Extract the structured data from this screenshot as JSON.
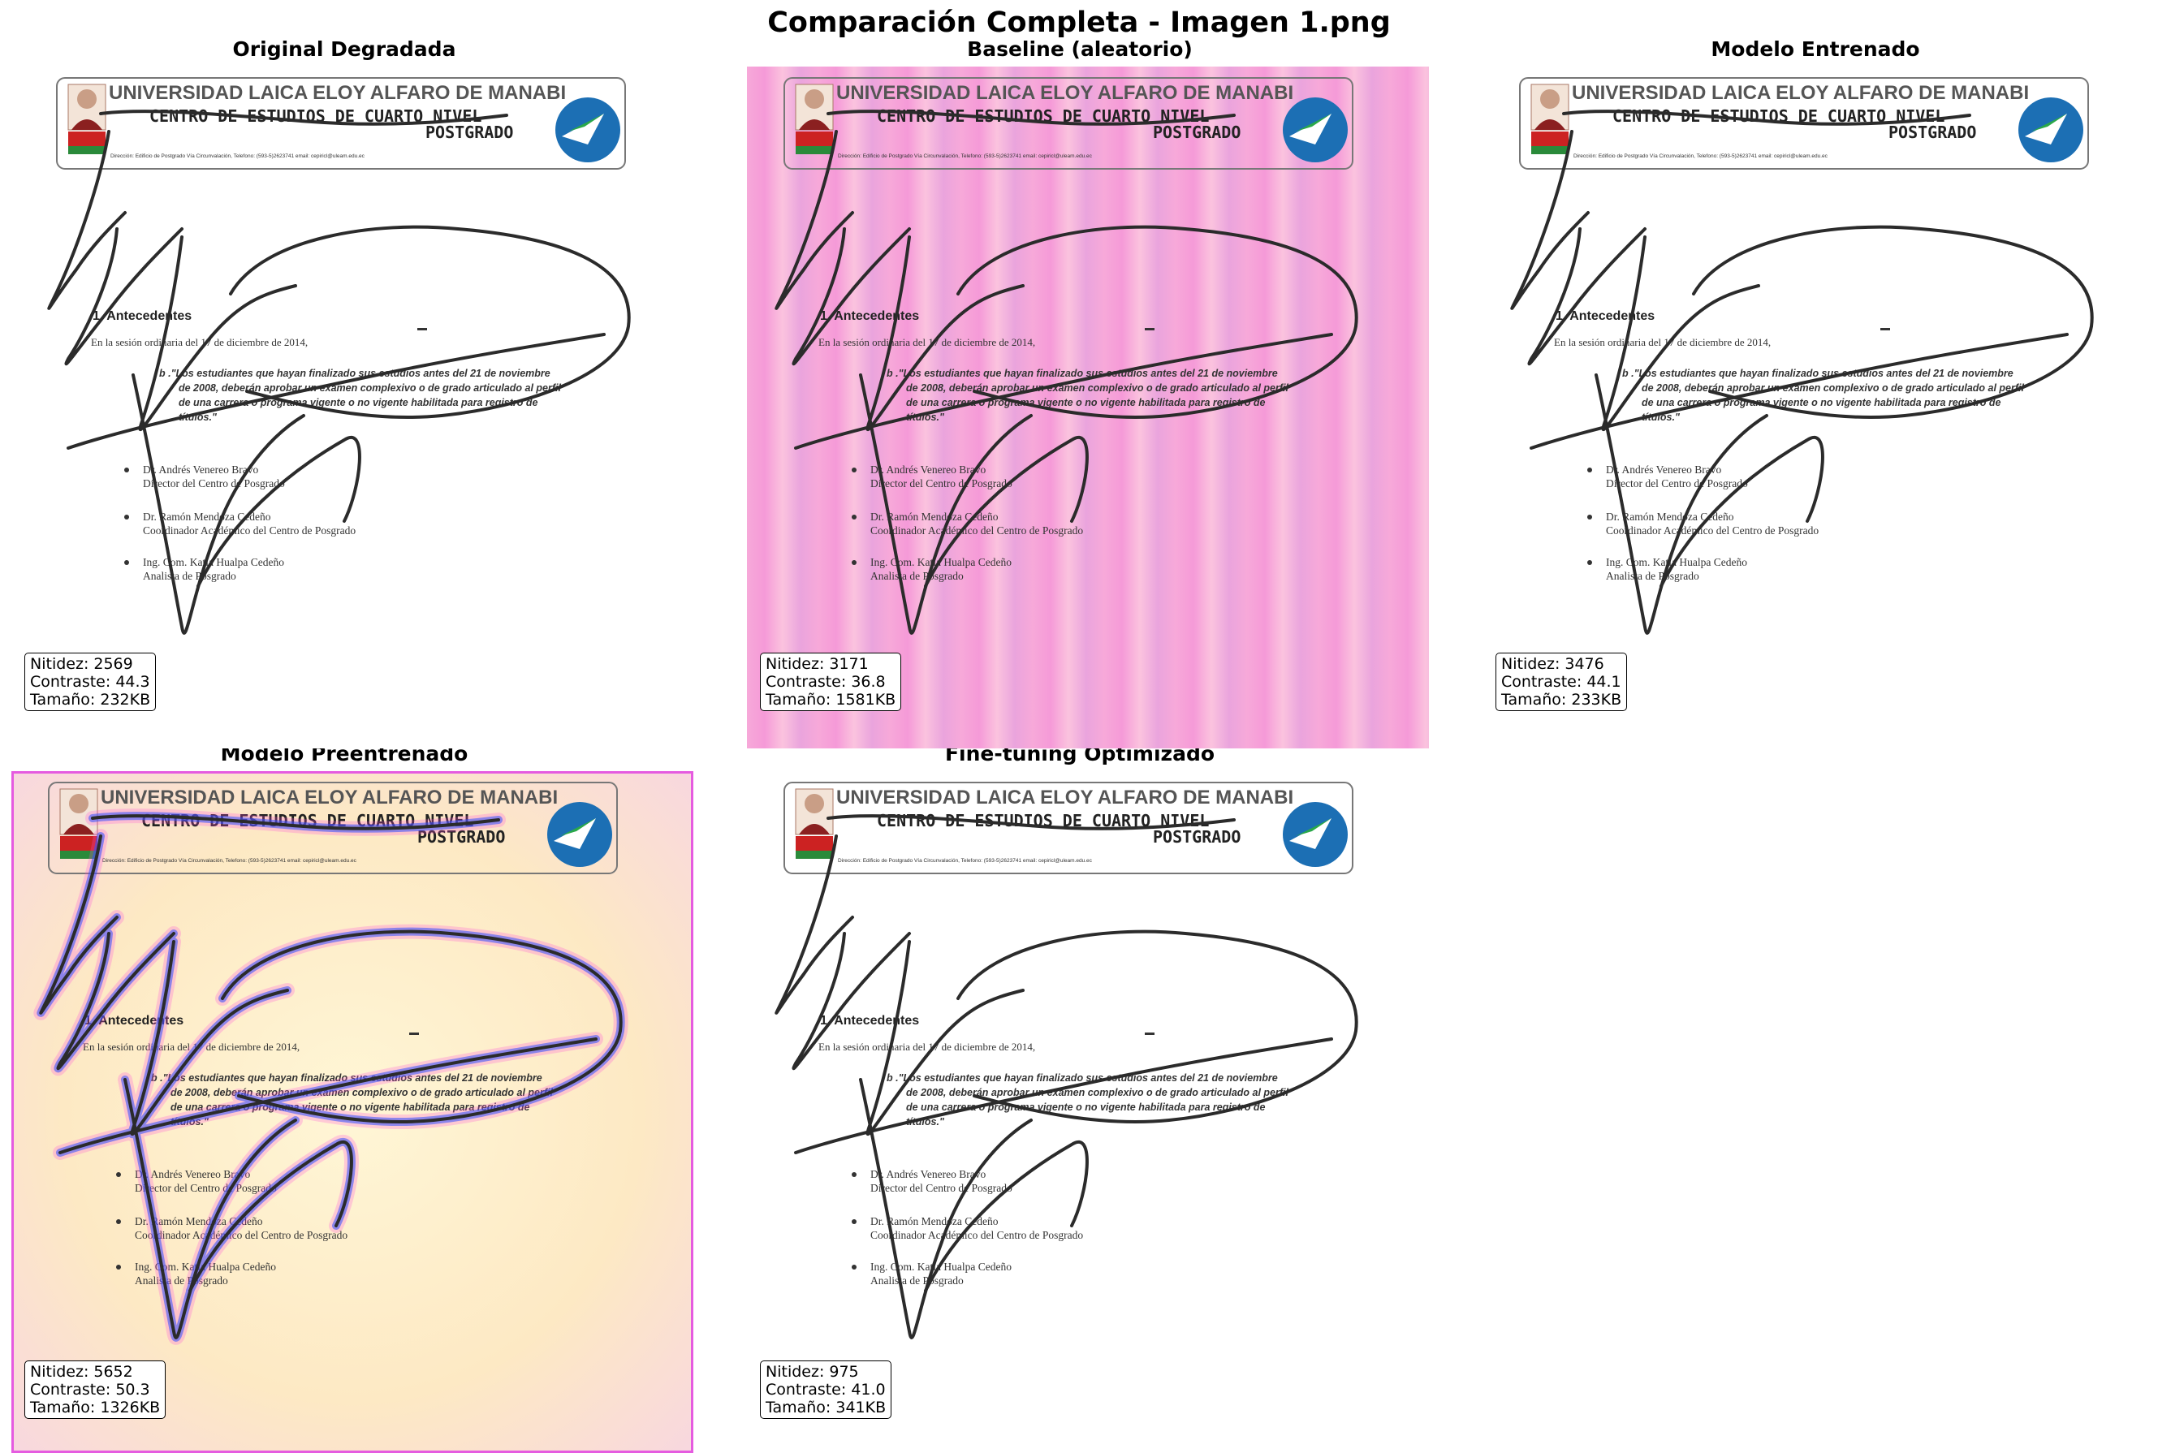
{
  "figure": {
    "title": "Comparación Completa - Imagen 1.png"
  },
  "document": {
    "university": "UNIVERSIDAD LAICA ELOY ALFARO DE MANABI",
    "center": "CENTRO DE ESTUDIOS DE CUARTO NIVEL",
    "postgrado": "POSTGRADO",
    "address": "Dirección: Edificio de Postgrado Vía Circunvalación, Telefono: (593-5)2623741 email: cepiricl@uleam.edu.ec",
    "heading": "1. Antecedentes",
    "session": "En la sesión ordinaria del 17 de diciembre de 2014,",
    "quote_1": "b .\"Los estudiantes que hayan finalizado sus estudios antes del 21 de noviembre",
    "quote_2": "de 2008, deberán aprobar un examen complexivo o de grado articulado al perfil",
    "quote_3": "de una carrera o programa vigente o no vigente habilitada para registro de",
    "quote_4": "títulos.\"",
    "person_1_name": "Dr. Andrés Venereo Bravo",
    "person_1_role": "Director del Centro de Posgrado",
    "person_2_name": "Dr. Ramón Mendoza Cedeño",
    "person_2_role": "Coordinador Académico del Centro de Posgrado",
    "person_3_name": "Ing. Com. Katia Hualpa Cedeño",
    "person_3_role": "Analista de Posgrado"
  },
  "panels": [
    {
      "title": "Original Degradada",
      "nitidez": "Nitidez: 2569",
      "contraste": "Contraste: 44.3",
      "tamano": "Tamaño: 232KB",
      "background": "#ffffff"
    },
    {
      "title": "Baseline (aleatorio)",
      "nitidez": "Nitidez: 3171",
      "contraste": "Contraste: 36.8",
      "tamano": "Tamaño: 1581KB",
      "background": "#f5a8da"
    },
    {
      "title": "Modelo Entrenado",
      "nitidez": "Nitidez: 3476",
      "contraste": "Contraste: 44.1",
      "tamano": "Tamaño: 233KB",
      "background": "#ffffff"
    },
    {
      "title": "Modelo Preentrenado",
      "nitidez": "Nitidez: 5652",
      "contraste": "Contraste: 50.3",
      "tamano": "Tamaño: 1326KB",
      "background": "#fdebc6"
    },
    {
      "title": "Fine-tuning Optimizado",
      "nitidez": "Nitidez: 975",
      "contraste": "Contraste: 41.0",
      "tamano": "Tamaño: 341KB",
      "background": "#ffffff"
    }
  ]
}
